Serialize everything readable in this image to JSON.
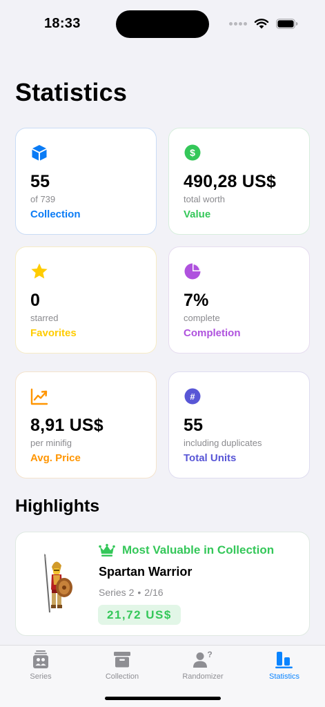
{
  "status_bar": {
    "time": "18:33"
  },
  "page_title": "Statistics",
  "cards": {
    "collection": {
      "value": "55",
      "sub": "of 739",
      "label": "Collection",
      "color": "#0a7bf5",
      "icon": "cube-icon"
    },
    "value": {
      "value": "490,28 US$",
      "sub": "total worth",
      "label": "Value",
      "color": "#34c759",
      "icon": "dollar-circle-icon"
    },
    "favorites": {
      "value": "0",
      "sub": "starred",
      "label": "Favorites",
      "color": "#ffcc00",
      "icon": "star-icon"
    },
    "completion": {
      "value": "7%",
      "sub": "complete",
      "label": "Completion",
      "color": "#af52de",
      "icon": "pie-chart-icon"
    },
    "avg_price": {
      "value": "8,91 US$",
      "sub": "per minifig",
      "label": "Avg. Price",
      "color": "#ff9500",
      "icon": "trend-up-icon"
    },
    "total_units": {
      "value": "55",
      "sub": "including duplicates",
      "label": "Total Units",
      "color": "#5856d6",
      "icon": "number-circle-icon"
    }
  },
  "highlights": {
    "title": "Highlights",
    "item": {
      "kicker": "Most Valuable in Collection",
      "name": "Spartan Warrior",
      "series": "Series 2",
      "separator": "•",
      "number": "2/16",
      "price": "21,72 US$",
      "icon": "crown-icon",
      "image": "spartan-warrior-minifig"
    }
  },
  "tabs": [
    {
      "label": "Series",
      "icon": "series-icon",
      "active": false
    },
    {
      "label": "Collection",
      "icon": "archive-box-icon",
      "active": false
    },
    {
      "label": "Randomizer",
      "icon": "person-question-icon",
      "active": false
    },
    {
      "label": "Statistics",
      "icon": "bar-chart-icon",
      "active": true
    }
  ],
  "colors": {
    "accent": "#0a84ff",
    "background": "#f2f2f7"
  }
}
